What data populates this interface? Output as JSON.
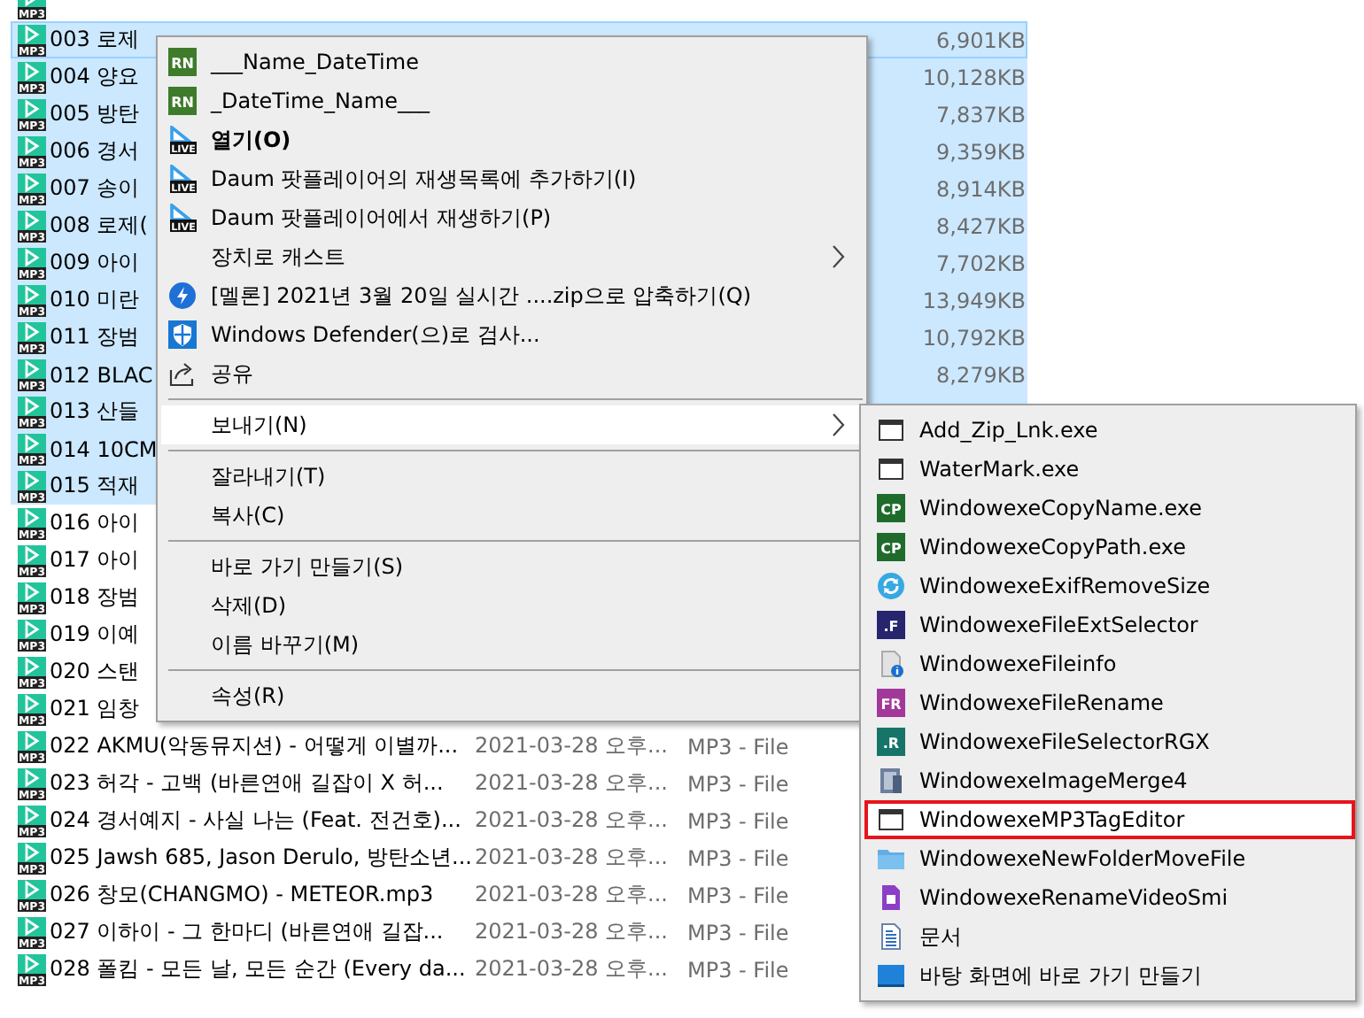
{
  "file_list": {
    "rows": [
      {
        "badge": "MP3",
        "selected": false,
        "focused": false
      },
      {
        "badge": "MP3",
        "name": "003 로제",
        "size": "6,901KB",
        "selected": true,
        "focused": true
      },
      {
        "badge": "MP3",
        "name": "004 양요",
        "size": "10,128KB",
        "selected": true,
        "focused": false
      },
      {
        "badge": "MP3",
        "name": "005 방탄",
        "size": "7,837KB",
        "selected": true,
        "focused": false
      },
      {
        "badge": "MP3",
        "name": "006 경서",
        "size": "9,359KB",
        "selected": true,
        "focused": false
      },
      {
        "badge": "MP3",
        "name": "007 송이",
        "size": "8,914KB",
        "selected": true,
        "focused": false
      },
      {
        "badge": "MP3",
        "name": "008 로제(",
        "size": "8,427KB",
        "selected": true,
        "focused": false
      },
      {
        "badge": "MP3",
        "name": "009 아이",
        "size": "7,702KB",
        "selected": true,
        "focused": false
      },
      {
        "badge": "MP3",
        "name": "010 미란",
        "size": "13,949KB",
        "selected": true,
        "focused": false
      },
      {
        "badge": "MP3",
        "name": "011 장범",
        "size": "10,792KB",
        "selected": true,
        "focused": false
      },
      {
        "badge": "MP3",
        "name": "012 BLAC",
        "size": "8,279KB",
        "selected": true,
        "focused": false
      },
      {
        "badge": "MP3",
        "name": "013 산들",
        "selected": true,
        "focused": false
      },
      {
        "badge": "MP3",
        "name": "014 10CM",
        "selected": true,
        "focused": false
      },
      {
        "badge": "MP3",
        "name": "015 적재",
        "selected": true,
        "focused": false
      },
      {
        "badge": "MP3",
        "name": "016 아이",
        "selected": false,
        "focused": false
      },
      {
        "badge": "MP3",
        "name": "017 아이",
        "selected": false,
        "focused": false
      },
      {
        "badge": "MP3",
        "name": "018 장범",
        "selected": false,
        "focused": false
      },
      {
        "badge": "MP3",
        "name": "019 이예",
        "selected": false,
        "focused": false
      },
      {
        "badge": "MP3",
        "name": "020 스탠",
        "selected": false,
        "focused": false
      },
      {
        "badge": "MP3",
        "name": "021 임창",
        "selected": false,
        "focused": false
      },
      {
        "badge": "MP3",
        "name": "022 AKMU(악동뮤지션) - 어떻게 이별까...",
        "date": "2021-03-28 오후...",
        "type": "MP3 - File",
        "selected": false,
        "focused": false
      },
      {
        "badge": "MP3",
        "name": "023 허각 - 고백 (바른연애 길잡이 X 허...",
        "date": "2021-03-28 오후...",
        "type": "MP3 - File",
        "selected": false,
        "focused": false
      },
      {
        "badge": "MP3",
        "name": "024 경서예지 - 사실 나는 (Feat. 전건호)...",
        "date": "2021-03-28 오후...",
        "type": "MP3 - File",
        "selected": false,
        "focused": false
      },
      {
        "badge": "MP3",
        "name": "025 Jawsh 685, Jason Derulo, 방탄소년...",
        "date": "2021-03-28 오후...",
        "type": "MP3 - File",
        "selected": false,
        "focused": false
      },
      {
        "badge": "MP3",
        "name": "026 창모(CHANGMO) - METEOR.mp3",
        "date": "2021-03-28 오후...",
        "type": "MP3 - File",
        "selected": false,
        "focused": false
      },
      {
        "badge": "MP3",
        "name": "027 이하이 - 그 한마디 (바른연애 길잡...",
        "date": "2021-03-28 오후...",
        "type": "MP3 - File",
        "selected": false,
        "focused": false
      },
      {
        "badge": "MP3",
        "name": "028 폴킴 - 모든 날, 모든 순간 (Every da...",
        "date": "2021-03-28 오후...",
        "type": "MP3 - File",
        "selected": false,
        "focused": false
      }
    ]
  },
  "context_menu": {
    "items": [
      {
        "kind": "rn",
        "badge": "RN",
        "label": "___Name_DateTime",
        "bold": false,
        "selected": false
      },
      {
        "kind": "rn",
        "badge": "RN",
        "label": "_DateTime_Name___",
        "bold": false,
        "selected": false
      },
      {
        "kind": "live",
        "badge": "LIVE",
        "label": "열기(O)",
        "bold": true,
        "selected": false
      },
      {
        "kind": "live",
        "badge": "LIVE",
        "label": "Daum 팟플레이어의 재생목록에 추가하기(I)",
        "bold": false,
        "selected": false
      },
      {
        "kind": "live",
        "badge": "LIVE",
        "label": "Daum 팟플레이어에서 재생하기(P)",
        "bold": false,
        "selected": false
      },
      {
        "kind": "submenu",
        "label": "장치로 캐스트",
        "bold": false,
        "selected": false
      },
      {
        "kind": "lightning",
        "label": "[멜론] 2021년 3월 20일 실시간 ....zip으로 압축하기(Q)",
        "bold": false,
        "selected": false
      },
      {
        "kind": "shield",
        "label": "Windows Defender(으)로 검사...",
        "bold": false,
        "selected": false
      },
      {
        "kind": "share",
        "label": "공유",
        "bold": false,
        "selected": false
      },
      {
        "kind": "separator"
      },
      {
        "kind": "submenu",
        "label": "보내기(N)",
        "bold": false,
        "selected": true
      },
      {
        "kind": "separator"
      },
      {
        "kind": "plain",
        "label": "잘라내기(T)",
        "bold": false,
        "selected": false
      },
      {
        "kind": "plain",
        "label": "복사(C)",
        "bold": false,
        "selected": false
      },
      {
        "kind": "separator"
      },
      {
        "kind": "plain",
        "label": "바로 가기 만들기(S)",
        "bold": false,
        "selected": false
      },
      {
        "kind": "plain",
        "label": "삭제(D)",
        "bold": false,
        "selected": false
      },
      {
        "kind": "plain",
        "label": "이름 바꾸기(M)",
        "bold": false,
        "selected": false
      },
      {
        "kind": "separator"
      },
      {
        "kind": "plain",
        "label": "속성(R)",
        "bold": false,
        "selected": false
      }
    ]
  },
  "send_to_menu": {
    "items": [
      {
        "kind": "window",
        "label": "Add_Zip_Lnk.exe",
        "highlighted": false
      },
      {
        "kind": "window",
        "label": "WaterMark.exe",
        "highlighted": false
      },
      {
        "kind": "badge",
        "badge": "CP",
        "color": "#1f6b2c",
        "label": "WindowexeCopyName.exe",
        "highlighted": false
      },
      {
        "kind": "badge",
        "badge": "CP",
        "color": "#1f6b2c",
        "label": "WindowexeCopyPath.exe",
        "highlighted": false
      },
      {
        "kind": "sync",
        "label": "WindowexeExifRemoveSize",
        "highlighted": false
      },
      {
        "kind": "badge",
        "badge": ".F",
        "color": "#27256e",
        "label": "WindowexeFileExtSelector",
        "highlighted": false
      },
      {
        "kind": "fileinfo",
        "label": "WindowexeFileinfo",
        "highlighted": false
      },
      {
        "kind": "badge",
        "badge": "FR",
        "color": "#a2399a",
        "label": "WindowexeFileRename",
        "highlighted": false
      },
      {
        "kind": "badge",
        "badge": ".R",
        "color": "#177468",
        "label": "WindowexeFileSelectorRGX",
        "highlighted": false
      },
      {
        "kind": "image",
        "label": "WindowexeImageMerge4",
        "highlighted": false
      },
      {
        "kind": "window",
        "label": "WindowexeMP3TagEditor",
        "highlighted": true
      },
      {
        "kind": "folder",
        "label": "WindowexeNewFolderMoveFile",
        "highlighted": false
      },
      {
        "kind": "video",
        "label": "WindowexeRenameVideoSmi",
        "highlighted": false
      },
      {
        "kind": "document",
        "label": "문서",
        "highlighted": false
      },
      {
        "kind": "desktop",
        "label": "바탕 화면에 바로 가기 만들기",
        "highlighted": false
      }
    ]
  }
}
